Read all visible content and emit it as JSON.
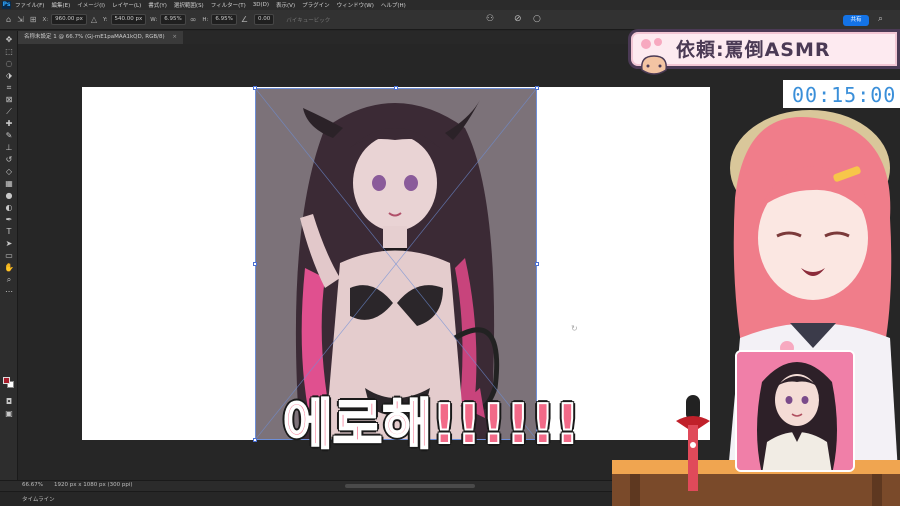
{
  "menu": {
    "logo": "Ps",
    "items": [
      "ファイル(F)",
      "編集(E)",
      "イメージ(I)",
      "レイヤー(L)",
      "書式(Y)",
      "選択範囲(S)",
      "フィルター(T)",
      "3D(D)",
      "表示(V)",
      "プラグイン",
      "ウィンドウ(W)",
      "ヘルプ(H)"
    ]
  },
  "options": {
    "x_label": "X:",
    "x_value": "960.00 px",
    "y_label": "Y:",
    "y_value": "540.00 px",
    "w_label": "W:",
    "w_value": "6.95%",
    "h_label": "H:",
    "h_value": "6.95%",
    "angle_value": "0.00",
    "interp_label": "バイキュービック",
    "share_label": "共有"
  },
  "document": {
    "tab_title": "名称未設定 1 @ 66.7% (Gj-mE1paMAA1kQD, RGB/8)",
    "close_glyph": "×"
  },
  "status": {
    "zoom": "66.67%",
    "size": "1920 px x 1080 px (300 ppi)",
    "timeline": "タイムライン"
  },
  "overlay": {
    "request_title": "依頼:罵倒ASMR",
    "timer": "00:15:00",
    "caption": "에로해!!!!!!"
  },
  "colors": {
    "accent_blue": "#1473e6",
    "caption_pink": "#f26a88",
    "banner_purple": "#4b3a55",
    "timer_blue": "#3a8fd9",
    "foreground_swatch": "#a71e2c"
  }
}
